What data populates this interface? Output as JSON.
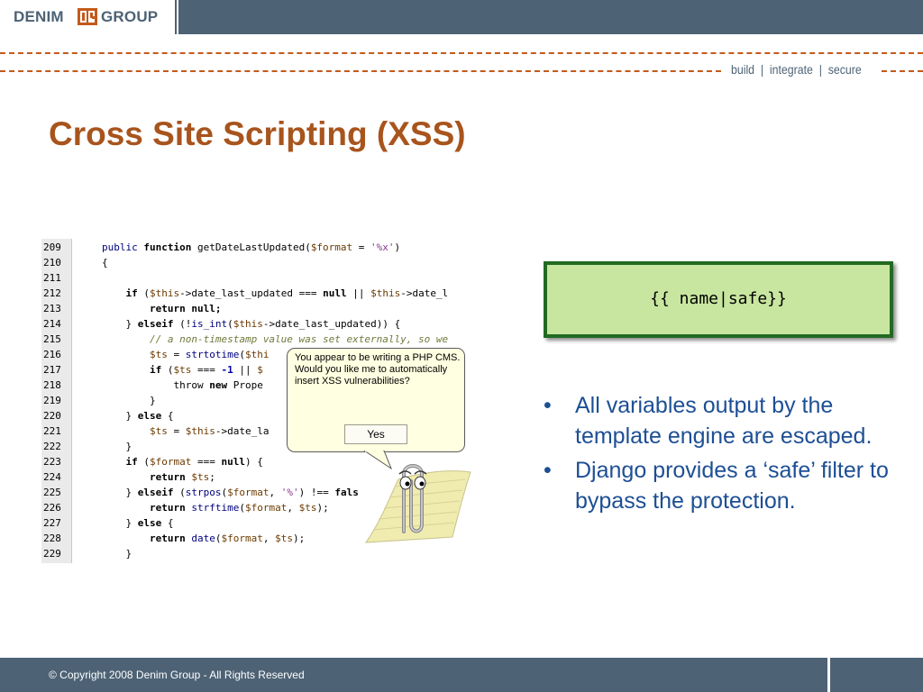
{
  "header": {
    "logo_left": "DENIM",
    "logo_right": "GROUP",
    "tagline": "build  |  integrate  |  secure",
    "brand_color": "#4d6275",
    "accent_color": "#c35a1b"
  },
  "slide": {
    "title": "Cross Site Scripting (XSS)",
    "title_color": "#a8541d"
  },
  "code_screenshot": {
    "lines": [
      {
        "num": "209"
      },
      {
        "num": "210"
      },
      {
        "num": "211"
      },
      {
        "num": "212"
      },
      {
        "num": "213"
      },
      {
        "num": "214"
      },
      {
        "num": "215"
      },
      {
        "num": "216"
      },
      {
        "num": "217"
      },
      {
        "num": "218"
      },
      {
        "num": "219"
      },
      {
        "num": "220"
      },
      {
        "num": "221"
      },
      {
        "num": "222"
      },
      {
        "num": "223"
      },
      {
        "num": "224"
      },
      {
        "num": "225"
      },
      {
        "num": "226"
      },
      {
        "num": "227"
      },
      {
        "num": "228"
      },
      {
        "num": "229"
      }
    ],
    "assistant_message": "You appear to be writing a PHP CMS.\nWould you like me to automatically insert XSS vulnerabilities?",
    "assistant_button": "Yes",
    "assistant_icon": "paperclip-assistant-icon"
  },
  "template_box": {
    "code": "{{ name|safe}}",
    "fill_color": "#c8e6a0",
    "border_color": "#226a22"
  },
  "bullets": [
    {
      "dot": "•",
      "text": "All variables output by the template engine are escaped."
    },
    {
      "dot": "•",
      "text": "Django provides a ‘safe’ filter to bypass the protection."
    }
  ],
  "bullet_color": "#1d4f94",
  "footer": {
    "copyright": "© Copyright 2008 Denim Group - All Rights Reserved"
  }
}
